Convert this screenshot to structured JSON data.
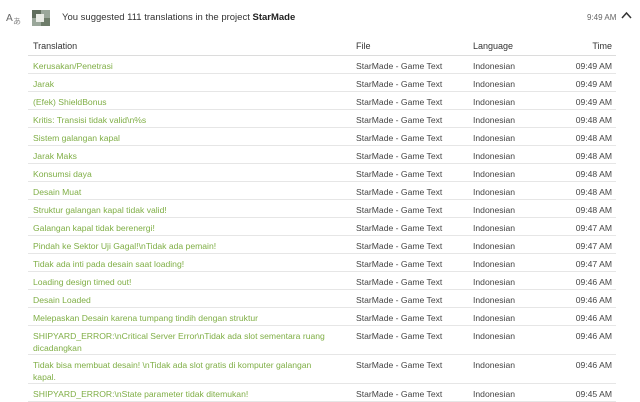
{
  "activity": {
    "summary_prefix": "You suggested 111 translations in the project",
    "project": "StarMade",
    "timestamp": "9:49 AM",
    "icons": [
      "translate-icon",
      "avatar",
      "chevron-up-icon"
    ]
  },
  "table": {
    "headers": {
      "translation": "Translation",
      "file": "File",
      "language": "Language",
      "time": "Time"
    },
    "rows": [
      {
        "translation": "Kerusakan/Penetrasi",
        "file": "StarMade - Game Text",
        "language": "Indonesian",
        "time": "09:49 AM",
        "lines": 1
      },
      {
        "translation": "Jarak",
        "file": "StarMade - Game Text",
        "language": "Indonesian",
        "time": "09:49 AM",
        "lines": 1
      },
      {
        "translation": "(Efek) ShieldBonus",
        "file": "StarMade - Game Text",
        "language": "Indonesian",
        "time": "09:49 AM",
        "lines": 1
      },
      {
        "translation": "Kritis: Transisi tidak valid\\n%s",
        "file": "StarMade - Game Text",
        "language": "Indonesian",
        "time": "09:48 AM",
        "lines": 1
      },
      {
        "translation": "Sistem galangan kapal",
        "file": "StarMade - Game Text",
        "language": "Indonesian",
        "time": "09:48 AM",
        "lines": 1
      },
      {
        "translation": "Jarak Maks",
        "file": "StarMade - Game Text",
        "language": "Indonesian",
        "time": "09:48 AM",
        "lines": 1
      },
      {
        "translation": "Konsumsi daya",
        "file": "StarMade - Game Text",
        "language": "Indonesian",
        "time": "09:48 AM",
        "lines": 1
      },
      {
        "translation": "Desain Muat",
        "file": "StarMade - Game Text",
        "language": "Indonesian",
        "time": "09:48 AM",
        "lines": 1
      },
      {
        "translation": "Struktur galangan kapal tidak valid!",
        "file": "StarMade - Game Text",
        "language": "Indonesian",
        "time": "09:48 AM",
        "lines": 1
      },
      {
        "translation": "Galangan kapal tidak berenergi!",
        "file": "StarMade - Game Text",
        "language": "Indonesian",
        "time": "09:47 AM",
        "lines": 1
      },
      {
        "translation": "Pindah ke Sektor Uji Gagal!\\nTidak ada pemain!",
        "file": "StarMade - Game Text",
        "language": "Indonesian",
        "time": "09:47 AM",
        "lines": 1
      },
      {
        "translation": "Tidak ada inti pada desain saat loading!",
        "file": "StarMade - Game Text",
        "language": "Indonesian",
        "time": "09:47 AM",
        "lines": 1
      },
      {
        "translation": "Loading design timed out!",
        "file": "StarMade - Game Text",
        "language": "Indonesian",
        "time": "09:46 AM",
        "lines": 1
      },
      {
        "translation": "Desain Loaded",
        "file": "StarMade - Game Text",
        "language": "Indonesian",
        "time": "09:46 AM",
        "lines": 1
      },
      {
        "translation": "Melepaskan Desain karena tumpang tindih dengan struktur",
        "file": "StarMade - Game Text",
        "language": "Indonesian",
        "time": "09:46 AM",
        "lines": 1
      },
      {
        "translation": "SHIPYARD_ERROR:\\nCritical Server Error\\nTidak ada slot sementara ruang dicadangkan",
        "file": "StarMade - Game Text",
        "language": "Indonesian",
        "time": "09:46 AM",
        "lines": 2
      },
      {
        "translation": "Tidak bisa membuat desain! \\nTidak ada slot gratis di komputer galangan kapal.",
        "file": "StarMade - Game Text",
        "language": "Indonesian",
        "time": "09:46 AM",
        "lines": 2
      },
      {
        "translation": "SHIPYARD_ERROR:\\nState parameter tidak ditemukan!",
        "file": "StarMade - Game Text",
        "language": "Indonesian",
        "time": "09:45 AM",
        "lines": 1
      }
    ]
  }
}
